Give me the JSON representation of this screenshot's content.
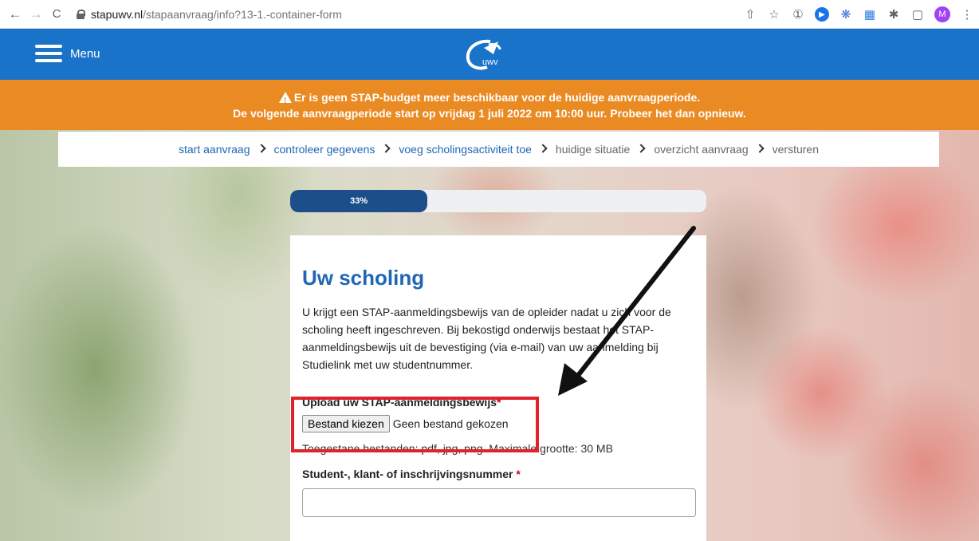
{
  "browser": {
    "back_icon": "←",
    "forward_icon": "→",
    "reload_icon": "C",
    "url_host": "stapuwv.nl",
    "url_path": "/stapaanvraag/info?13-1.-container-form",
    "avatar_letter": "M"
  },
  "header": {
    "menu_label": "Menu",
    "logo_text": "uwv",
    "brand_color": "#1973c9"
  },
  "banner": {
    "line1": "Er is geen STAP-budget meer beschikbaar voor de huidige aanvraagperiode.",
    "line2": "De volgende aanvraagperiode start op vrijdag 1 juli 2022 om 10:00 uur. Probeer het dan opnieuw.",
    "color": "#ea8a23"
  },
  "breadcrumb": {
    "items": [
      {
        "label": "start aanvraag",
        "active": true
      },
      {
        "label": "controleer gegevens",
        "active": true
      },
      {
        "label": "voeg scholingsactiviteit toe",
        "active": true
      },
      {
        "label": "huidige situatie",
        "active": false
      },
      {
        "label": "overzicht aanvraag",
        "active": false
      },
      {
        "label": "versturen",
        "active": false
      }
    ]
  },
  "progress": {
    "label": "33%",
    "value": 0.33
  },
  "form": {
    "title": "Uw scholing",
    "intro": "U krijgt een STAP-aanmeldingsbewijs van de opleider nadat u zich voor de scholing heeft ingeschreven. Bij bekostigd onderwijs bestaat het STAP-aanmeldingsbewijs uit de bevestiging (via e-mail) van uw aanmelding bij Studielink met uw studentnummer.",
    "upload_label": "Upload uw STAP-aanmeldingsbewijs",
    "required_mark": "*",
    "file_button": "Bestand kiezen",
    "file_status": "Geen bestand gekozen",
    "allowed_hint": "Toegestane bestanden: pdf, jpg, png. Maximale grootte: 30 MB",
    "student_label": "Student-, klant- of inschrijvingsnummer",
    "student_value": ""
  }
}
